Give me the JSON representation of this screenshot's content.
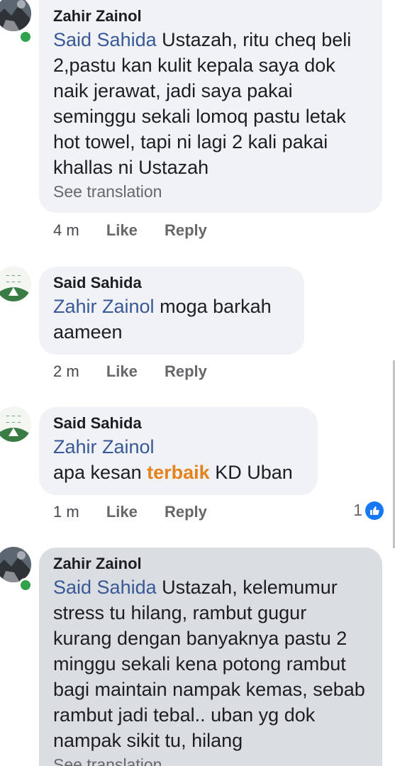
{
  "comments": [
    {
      "author": "Zahir Zainol",
      "mention": "Said Sahida",
      "text": "Ustazah, ritu cheq beli 2,pastu kan kulit kepala saya dok naik jerawat, jadi saya pakai seminggu sekali lomoq pastu letak hot towel, tapi ni lagi 2 kali pakai khallas ni Ustazah",
      "see_translation": "See translation",
      "time": "4 m",
      "like_label": "Like",
      "reply_label": "Reply"
    },
    {
      "author": "Said Sahida",
      "mention": "Zahir Zainol",
      "text": "moga barkah aameen",
      "time": "2 m",
      "like_label": "Like",
      "reply_label": "Reply"
    },
    {
      "author": "Said Sahida",
      "mention": "Zahir Zainol",
      "text_before": "apa kesan",
      "text_highlight": "terbaik",
      "text_after": "KD Uban",
      "time": "1 m",
      "like_label": "Like",
      "reply_label": "Reply",
      "reaction_count": "1"
    },
    {
      "author": "Zahir Zainol",
      "mention": "Said Sahida",
      "text": "Ustazah, kelemumur stress tu hilang, rambut gugur kurang dengan banyaknya pastu 2 minggu sekali kena potong rambut bagi maintain nampak kemas, sebab rambut jadi tebal.. uban yg dok nampak sikit tu, hilang",
      "see_translation": "See translation"
    }
  ],
  "colors": {
    "mention": "#385898",
    "highlight": "#e4821d",
    "bubble": "#f0f2f5",
    "bubble_selected": "#dadde1",
    "online": "#31a24c",
    "like_badge": "#1877f2"
  },
  "icons": {
    "online": "online-status-dot",
    "reaction": "like-reaction-icon"
  }
}
